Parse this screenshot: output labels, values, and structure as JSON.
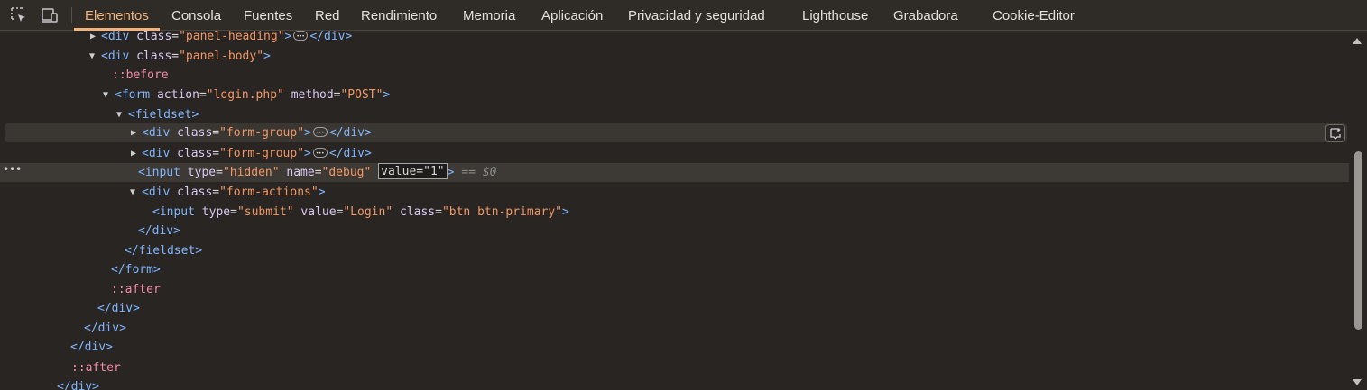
{
  "tabs": [
    {
      "label": "Elementos",
      "active": true
    },
    {
      "label": "Consola"
    },
    {
      "label": "Fuentes"
    },
    {
      "label": "Red"
    },
    {
      "label": "Rendimiento"
    },
    {
      "label": "Memoria"
    },
    {
      "label": "Aplicación"
    },
    {
      "label": "Privacidad y seguridad"
    },
    {
      "label": "Lighthouse"
    },
    {
      "label": "Grabadora"
    },
    {
      "label": "Cookie-Editor"
    }
  ],
  "toolbar_icons": [
    "inspect-element-icon",
    "device-toolbar-icon"
  ],
  "tree": {
    "r0": {
      "t1": "<div",
      "a1": "class",
      "v1": "\"panel-heading\"",
      "t2": ">",
      "t3": "</div>"
    },
    "r1": {
      "t1": "<div",
      "a1": "class",
      "v1": "\"panel-body\"",
      "t2": ">"
    },
    "r2": {
      "pe": "::before"
    },
    "r3": {
      "t1": "<form",
      "a1": "action",
      "v1": "\"login.php\"",
      "a2": "method",
      "v2": "\"POST\"",
      "t2": ">"
    },
    "r4": {
      "t1": "<fieldset>"
    },
    "r5": {
      "t1": "<div",
      "a1": "class",
      "v1": "\"form-group\"",
      "t2": ">",
      "t3": "</div>"
    },
    "r6": {
      "t1": "<div",
      "a1": "class",
      "v1": "\"form-group\"",
      "t2": ">",
      "t3": "</div>"
    },
    "r7": {
      "t1": "<input",
      "a1": "type",
      "v1": "\"hidden\"",
      "a2": "name",
      "v2": "\"debug\"",
      "edit": "value=\"1\"",
      "t2": ">",
      "ref": "== $0"
    },
    "r8": {
      "t1": "<div",
      "a1": "class",
      "v1": "\"form-actions\"",
      "t2": ">"
    },
    "r9": {
      "t1": "<input",
      "a1": "type",
      "v1": "\"submit\"",
      "a2": "value",
      "v2": "\"Login\"",
      "a3": "class",
      "v3": "\"btn btn-primary\"",
      "t2": ">"
    },
    "r10": {
      "t1": "</div>"
    },
    "r11": {
      "t1": "</fieldset>"
    },
    "r12": {
      "t1": "</form>"
    },
    "r13": {
      "pe": "::after"
    },
    "r14": {
      "t1": "</div>"
    },
    "r15": {
      "t1": "</div>"
    },
    "r16": {
      "t1": "</div>"
    },
    "r17": {
      "pe": "::after"
    },
    "r18": {
      "t1": "</div>"
    }
  }
}
